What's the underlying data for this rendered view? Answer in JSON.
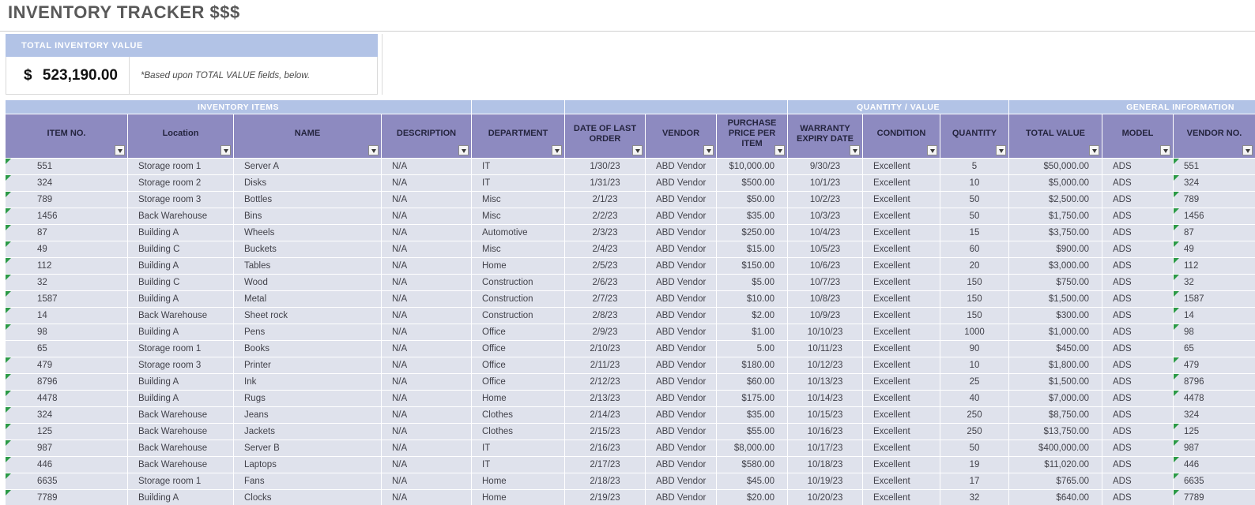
{
  "page": {
    "title": "INVENTORY TRACKER $$$"
  },
  "summary": {
    "header": "TOTAL INVENTORY VALUE",
    "currency_symbol": "$",
    "amount": "523,190.00",
    "note": "*Based upon TOTAL VALUE fields, below."
  },
  "colors": {
    "header_purple": "#8d8ac0",
    "group_blue": "#b2c3e6",
    "row_background": "#dfe2ec",
    "error_indicator_green": "#2c9a47",
    "title_gray": "#595959"
  },
  "table": {
    "group_headers": [
      {
        "id": "inventory-items",
        "label": "INVENTORY ITEMS"
      },
      {
        "id": "spacer-1",
        "label": ""
      },
      {
        "id": "spacer-2",
        "label": ""
      },
      {
        "id": "quantity-value",
        "label": "QUANTITY / VALUE"
      },
      {
        "id": "general-information",
        "label": "GENERAL INFORMATION"
      }
    ],
    "columns": [
      {
        "id": "item-no",
        "label": "ITEM NO."
      },
      {
        "id": "location",
        "label": "Location"
      },
      {
        "id": "name",
        "label": "NAME"
      },
      {
        "id": "description",
        "label": "DESCRIPTION"
      },
      {
        "id": "department",
        "label": "DEPARTMENT"
      },
      {
        "id": "date-of-last-order",
        "label": "DATE OF LAST ORDER"
      },
      {
        "id": "vendor",
        "label": "VENDOR"
      },
      {
        "id": "purchase-price-per-item",
        "label": "PURCHASE PRICE PER ITEM"
      },
      {
        "id": "warranty-expiry-date",
        "label": "WARRANTY EXPIRY DATE"
      },
      {
        "id": "condition",
        "label": "CONDITION"
      },
      {
        "id": "quantity",
        "label": "QUANTITY"
      },
      {
        "id": "total-value",
        "label": "TOTAL VALUE"
      },
      {
        "id": "model",
        "label": "MODEL"
      },
      {
        "id": "vendor-no",
        "label": "VENDOR NO."
      }
    ],
    "rows": [
      {
        "cells": [
          "551",
          "Storage room 1",
          "Server A",
          "N/A",
          "IT",
          "1/30/23",
          "ABD Vendor",
          "$10,000.00",
          "9/30/23",
          "Excellent",
          "5",
          "$50,000.00",
          "ADS",
          "551"
        ],
        "item_flag": true,
        "vendor_flag": true
      },
      {
        "cells": [
          "324",
          "Storage room 2",
          "Disks",
          "N/A",
          "IT",
          "1/31/23",
          "ABD Vendor",
          "$500.00",
          "10/1/23",
          "Excellent",
          "10",
          "$5,000.00",
          "ADS",
          "324"
        ],
        "item_flag": true,
        "vendor_flag": true
      },
      {
        "cells": [
          "789",
          "Storage room 3",
          "Bottles",
          "N/A",
          "Misc",
          "2/1/23",
          "ABD Vendor",
          "$50.00",
          "10/2/23",
          "Excellent",
          "50",
          "$2,500.00",
          "ADS",
          "789"
        ],
        "item_flag": true,
        "vendor_flag": true
      },
      {
        "cells": [
          "1456",
          "Back Warehouse",
          "Bins",
          "N/A",
          "Misc",
          "2/2/23",
          "ABD Vendor",
          "$35.00",
          "10/3/23",
          "Excellent",
          "50",
          "$1,750.00",
          "ADS",
          "1456"
        ],
        "item_flag": true,
        "vendor_flag": true
      },
      {
        "cells": [
          "87",
          "Building A",
          "Wheels",
          "N/A",
          "Automotive",
          "2/3/23",
          "ABD Vendor",
          "$250.00",
          "10/4/23",
          "Excellent",
          "15",
          "$3,750.00",
          "ADS",
          "87"
        ],
        "item_flag": true,
        "vendor_flag": true
      },
      {
        "cells": [
          "49",
          "Building C",
          "Buckets",
          "N/A",
          "Misc",
          "2/4/23",
          "ABD Vendor",
          "$15.00",
          "10/5/23",
          "Excellent",
          "60",
          "$900.00",
          "ADS",
          "49"
        ],
        "item_flag": true,
        "vendor_flag": true
      },
      {
        "cells": [
          "112",
          "Building A",
          "Tables",
          "N/A",
          "Home",
          "2/5/23",
          "ABD Vendor",
          "$150.00",
          "10/6/23",
          "Excellent",
          "20",
          "$3,000.00",
          "ADS",
          "112"
        ],
        "item_flag": true,
        "vendor_flag": true
      },
      {
        "cells": [
          "32",
          "Building C",
          "Wood",
          "N/A",
          "Construction",
          "2/6/23",
          "ABD Vendor",
          "$5.00",
          "10/7/23",
          "Excellent",
          "150",
          "$750.00",
          "ADS",
          "32"
        ],
        "item_flag": true,
        "vendor_flag": true
      },
      {
        "cells": [
          "1587",
          "Building A",
          "Metal",
          "N/A",
          "Construction",
          "2/7/23",
          "ABD Vendor",
          "$10.00",
          "10/8/23",
          "Excellent",
          "150",
          "$1,500.00",
          "ADS",
          "1587"
        ],
        "item_flag": true,
        "vendor_flag": true
      },
      {
        "cells": [
          "14",
          "Back Warehouse",
          "Sheet rock",
          "N/A",
          "Construction",
          "2/8/23",
          "ABD Vendor",
          "$2.00",
          "10/9/23",
          "Excellent",
          "150",
          "$300.00",
          "ADS",
          "14"
        ],
        "item_flag": true,
        "vendor_flag": true
      },
      {
        "cells": [
          "98",
          "Building A",
          "Pens",
          "N/A",
          "Office",
          "2/9/23",
          "ABD Vendor",
          "$1.00",
          "10/10/23",
          "Excellent",
          "1000",
          "$1,000.00",
          "ADS",
          "98"
        ],
        "item_flag": true,
        "vendor_flag": true
      },
      {
        "cells": [
          "65",
          "Storage room 1",
          "Books",
          "N/A",
          "Office",
          "2/10/23",
          "ABD Vendor",
          "5.00",
          "10/11/23",
          "Excellent",
          "90",
          "$450.00",
          "ADS",
          "65"
        ],
        "item_flag": false,
        "vendor_flag": false
      },
      {
        "cells": [
          "479",
          "Storage room 3",
          "Printer",
          "N/A",
          "Office",
          "2/11/23",
          "ABD Vendor",
          "$180.00",
          "10/12/23",
          "Excellent",
          "10",
          "$1,800.00",
          "ADS",
          "479"
        ],
        "item_flag": true,
        "vendor_flag": true
      },
      {
        "cells": [
          "8796",
          "Building A",
          "Ink",
          "N/A",
          "Office",
          "2/12/23",
          "ABD Vendor",
          "$60.00",
          "10/13/23",
          "Excellent",
          "25",
          "$1,500.00",
          "ADS",
          "8796"
        ],
        "item_flag": true,
        "vendor_flag": true
      },
      {
        "cells": [
          "4478",
          "Building A",
          "Rugs",
          "N/A",
          "Home",
          "2/13/23",
          "ABD Vendor",
          "$175.00",
          "10/14/23",
          "Excellent",
          "40",
          "$7,000.00",
          "ADS",
          "4478"
        ],
        "item_flag": true,
        "vendor_flag": true
      },
      {
        "cells": [
          "324",
          "Back Warehouse",
          "Jeans",
          "N/A",
          "Clothes",
          "2/14/23",
          "ABD Vendor",
          "$35.00",
          "10/15/23",
          "Excellent",
          "250",
          "$8,750.00",
          "ADS",
          "324"
        ],
        "item_flag": true,
        "vendor_flag": false
      },
      {
        "cells": [
          "125",
          "Back Warehouse",
          "Jackets",
          "N/A",
          "Clothes",
          "2/15/23",
          "ABD Vendor",
          "$55.00",
          "10/16/23",
          "Excellent",
          "250",
          "$13,750.00",
          "ADS",
          "125"
        ],
        "item_flag": true,
        "vendor_flag": true
      },
      {
        "cells": [
          "987",
          "Back Warehouse",
          "Server B",
          "N/A",
          "IT",
          "2/16/23",
          "ABD Vendor",
          "$8,000.00",
          "10/17/23",
          "Excellent",
          "50",
          "$400,000.00",
          "ADS",
          "987"
        ],
        "item_flag": true,
        "vendor_flag": true
      },
      {
        "cells": [
          "446",
          "Back Warehouse",
          "Laptops",
          "N/A",
          "IT",
          "2/17/23",
          "ABD Vendor",
          "$580.00",
          "10/18/23",
          "Excellent",
          "19",
          "$11,020.00",
          "ADS",
          "446"
        ],
        "item_flag": true,
        "vendor_flag": true
      },
      {
        "cells": [
          "6635",
          "Storage room 1",
          "Fans",
          "N/A",
          "Home",
          "2/18/23",
          "ABD Vendor",
          "$45.00",
          "10/19/23",
          "Excellent",
          "17",
          "$765.00",
          "ADS",
          "6635"
        ],
        "item_flag": true,
        "vendor_flag": true
      },
      {
        "cells": [
          "7789",
          "Building A",
          "Clocks",
          "N/A",
          "Home",
          "2/19/23",
          "ABD Vendor",
          "$20.00",
          "10/20/23",
          "Excellent",
          "32",
          "$640.00",
          "ADS",
          "7789"
        ],
        "item_flag": true,
        "vendor_flag": true
      }
    ]
  }
}
